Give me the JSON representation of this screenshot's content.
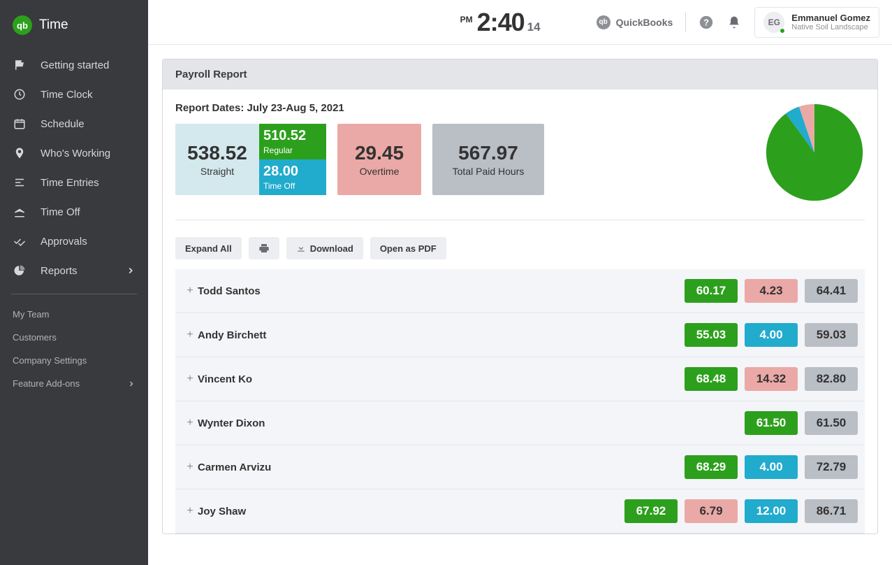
{
  "sidebar": {
    "brand": "Time",
    "brand_glyph": "qb",
    "nav": [
      {
        "label": "Getting started"
      },
      {
        "label": "Time Clock"
      },
      {
        "label": "Schedule"
      },
      {
        "label": "Who's Working"
      },
      {
        "label": "Time Entries"
      },
      {
        "label": "Time Off"
      },
      {
        "label": "Approvals"
      },
      {
        "label": "Reports",
        "chevron": true
      }
    ],
    "subnav": [
      {
        "label": "My Team"
      },
      {
        "label": "Customers"
      },
      {
        "label": "Company Settings"
      },
      {
        "label": "Feature Add-ons",
        "chevron": true
      }
    ]
  },
  "topbar": {
    "ampm": "PM",
    "time": "2:40",
    "seconds": "14",
    "quickbooks": "QuickBooks",
    "user_initials": "EG",
    "user_name": "Emmanuel Gomez",
    "user_org": "Native Soil Landscape"
  },
  "report": {
    "title": "Payroll Report",
    "dates_label": "Report Dates: July 23-Aug 5, 2021",
    "summary": {
      "straight_value": "538.52",
      "straight_label": "Straight",
      "regular_value": "510.52",
      "regular_label": "Regular",
      "timeoff_value": "28.00",
      "timeoff_label": "Time Off",
      "overtime_value": "29.45",
      "overtime_label": "Overtime",
      "total_value": "567.97",
      "total_label": "Total Paid Hours"
    },
    "toolbar": {
      "expand": "Expand All",
      "download": "Download",
      "open_pdf": "Open as PDF"
    },
    "rows": [
      {
        "name": "Todd Santos",
        "green": "60.17",
        "pink": "4.23",
        "cyan": null,
        "grey": "64.41"
      },
      {
        "name": "Andy Birchett",
        "green": "55.03",
        "pink": null,
        "cyan": "4.00",
        "grey": "59.03"
      },
      {
        "name": "Vincent Ko",
        "green": "68.48",
        "pink": "14.32",
        "cyan": null,
        "grey": "82.80"
      },
      {
        "name": "Wynter Dixon",
        "green": "61.50",
        "pink": null,
        "cyan": null,
        "grey": "61.50"
      },
      {
        "name": "Carmen Arvizu",
        "green": "68.29",
        "pink": null,
        "cyan": "4.00",
        "grey": "72.79"
      },
      {
        "name": "Joy Shaw",
        "green": "67.92",
        "pink": "6.79",
        "cyan": "12.00",
        "grey": "86.71"
      }
    ]
  },
  "chart_data": {
    "type": "pie",
    "title": "",
    "series": [
      {
        "name": "Regular",
        "value": 510.52,
        "color": "#2ca01c"
      },
      {
        "name": "Time Off",
        "value": 28.0,
        "color": "#21abcd"
      },
      {
        "name": "Overtime",
        "value": 29.45,
        "color": "#eaa9a6"
      }
    ],
    "total": 567.97
  }
}
